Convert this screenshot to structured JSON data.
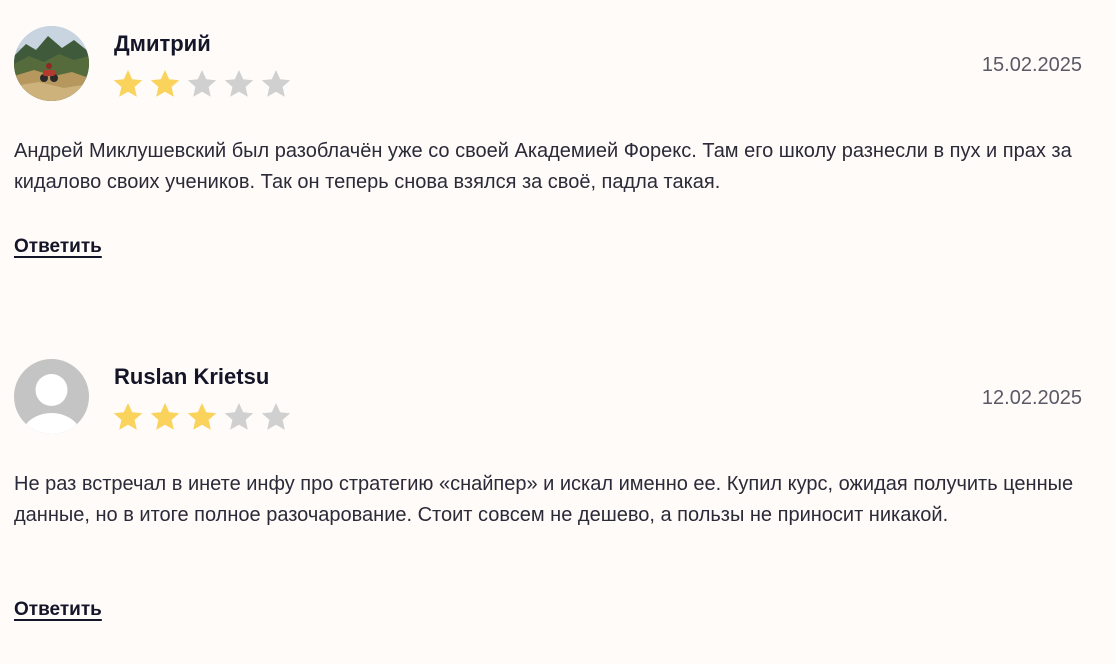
{
  "colors": {
    "background": "#fffbf8",
    "star_filled": "#f9d35b",
    "star_empty": "#d0d0d0",
    "text": "#2a2a38",
    "author": "#141528",
    "date": "#5a5a66"
  },
  "reviews": [
    {
      "author": "Дмитрий",
      "avatar": "photo-avatar",
      "rating": 2,
      "max_rating": 5,
      "date": "15.02.2025",
      "text": "Андрей Миклушевский был разоблачён уже со своей Академией Форекс. Там его школу разнесли в пух и прах за кидалово своих учеников. Так он теперь снова взялся за своё, падла такая.",
      "reply_label": "Ответить"
    },
    {
      "author": "Ruslan Krietsu",
      "avatar": "default-user-avatar",
      "rating": 3,
      "max_rating": 5,
      "date": "12.02.2025",
      "text": "Не раз встречал в инете инфу про стратегию «снайпер» и искал именно ее. Купил курс, ожидая получить ценные данные, но в итоге полное разочарование. Стоит совсем не дешево, а пользы не приносит никакой.",
      "reply_label": "Ответить"
    }
  ]
}
